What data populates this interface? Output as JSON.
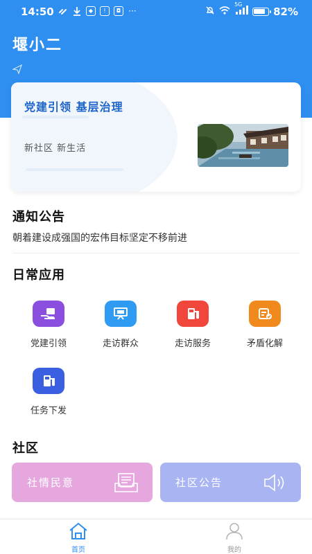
{
  "status_bar": {
    "time": "14:50",
    "battery_percent_label": "82%",
    "battery_level": 0.82,
    "network_label": "5G",
    "more_label": "···"
  },
  "header": {
    "title": "堰小二"
  },
  "banner": {
    "title": "党建引领  基层治理",
    "subtitle": "新社区  新生活"
  },
  "notice": {
    "section_title": "通知公告",
    "text": "朝着建设成强国的宏伟目标坚定不移前进"
  },
  "daily_apps": {
    "section_title": "日常应用",
    "items": [
      {
        "label": "党建引领",
        "icon": "hand-card-icon",
        "color": "#8b4fe0"
      },
      {
        "label": "走访群众",
        "icon": "presentation-icon",
        "color": "#2f9bf2"
      },
      {
        "label": "走访服务",
        "icon": "fuel-pump-icon",
        "color": "#f0463c"
      },
      {
        "label": "矛盾化解",
        "icon": "box-check-icon",
        "color": "#f08a1c"
      },
      {
        "label": "任务下发",
        "icon": "task-pump-icon",
        "color": "#3a5fe0"
      }
    ]
  },
  "community": {
    "section_title": "社区",
    "cards": [
      {
        "label": "社情民意",
        "icon": "document-tray-icon",
        "color": "#e6a7df"
      },
      {
        "label": "社区公告",
        "icon": "speaker-icon",
        "color": "#a9b5f3"
      }
    ]
  },
  "tabbar": {
    "tabs": [
      {
        "label": "首页",
        "icon": "home-icon",
        "active": true
      },
      {
        "label": "我的",
        "icon": "user-icon",
        "active": false
      }
    ],
    "active_color": "#2f8ff0",
    "inactive_color": "#999999"
  }
}
